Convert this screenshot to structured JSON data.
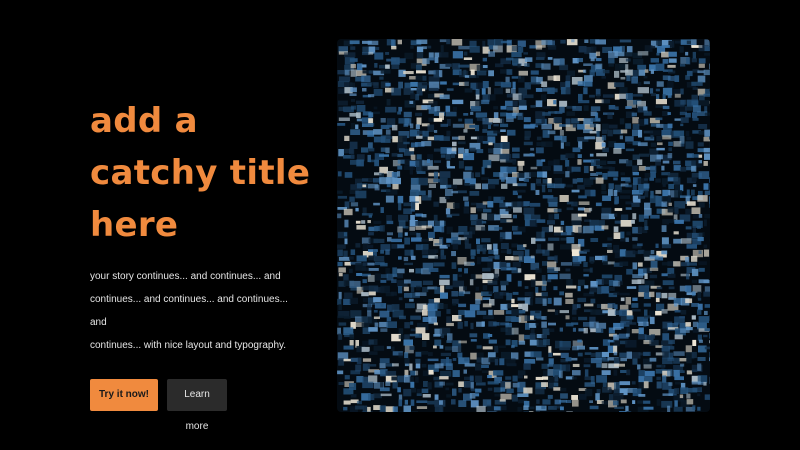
{
  "hero": {
    "title_lines": [
      "add a",
      "catchy title",
      "here"
    ],
    "body_lines": [
      "your story continues... and continues... and",
      "continues... and continues... and continues... and",
      "continues... with nice layout and typography."
    ],
    "primary_button_label": "Try it now!",
    "secondary_button_label": "Learn more"
  },
  "colors": {
    "background": "#000000",
    "accent": "#f08a3e",
    "text": "#e6e6e6",
    "secondary_button": "#2b2b2b",
    "art_palette": [
      "#0b1c2c",
      "#16314b",
      "#24517a",
      "#3a73a8",
      "#5f93c4",
      "#a9b9c4",
      "#d6d1c4",
      "#efe7d6"
    ]
  },
  "art": {
    "kind": "abstract noise texture"
  }
}
